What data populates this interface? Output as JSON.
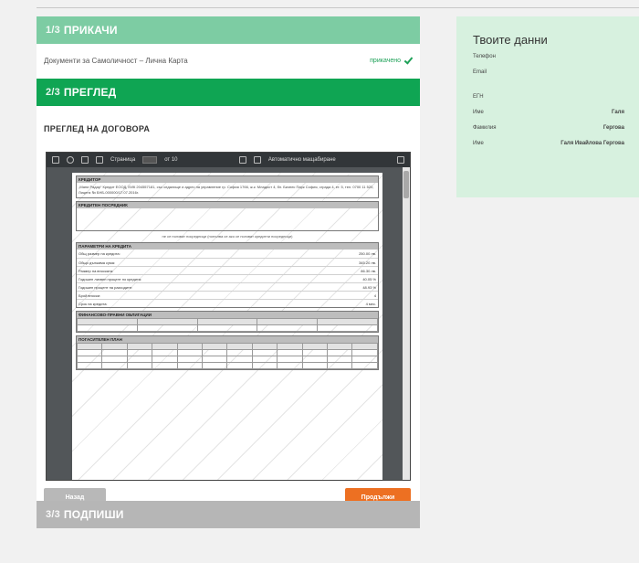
{
  "steps": {
    "step1": {
      "number": "1/3",
      "title": "ПРИКАЧИ"
    },
    "step2": {
      "number": "2/3",
      "title": "ПРЕГЛЕД"
    },
    "step3": {
      "number": "3/3",
      "title": "ПОДПИШИ"
    }
  },
  "upload": {
    "documents_text": "Документи за Самоличност – Лична Карта",
    "done_label": "прикачено"
  },
  "review": {
    "heading": "ПРЕГЛЕД НА ДОГОВОРА"
  },
  "viewer": {
    "page_label": "Страница",
    "page_of": "от 10",
    "zoom_label": "Автоматично мащабиране"
  },
  "pdf": {
    "creditor_head": "КРЕДИТОР",
    "creditor_body": "„Мани Радар“ Кредит ЕООД, ЕИК 204557181, със седалище и адрес на управление гр. София 1766, ж.к. Младост 4, бл. Бизнес Парк София, сграда 4, ет. 5, тел. 0700 11 520, Лиценз № БНБ-000000/17.07.2016г.",
    "intermediary_head": "КРЕДИТЕН ПОСРЕДНИК",
    "intermediary_note": "не се ползват посредници (попълва се ако се ползват кредитни посредници)",
    "params_head": "ПАРАМЕТРИ НА КРЕДИТА",
    "params": [
      {
        "label": "Общ размер на кредита:",
        "value": "250.00 лв."
      },
      {
        "label": "Общо дължима сума:",
        "value": "345.20 лв."
      },
      {
        "label": "Размер на вноската:",
        "value": "86.30 лв."
      },
      {
        "label": "Годишен лихвен процент по кредита:",
        "value": "40.05 %"
      },
      {
        "label": "Годишен процент на разходите:",
        "value": "48.93 %"
      },
      {
        "label": "Брой вноски:",
        "value": "4"
      },
      {
        "label": "Срок на кредита:",
        "value": "4 мес."
      }
    ],
    "financial_head": "ФИНАНСОВО-ПРАВНИ ОБЛИГАЦИИ",
    "schedule_head": "ПОГАСИТЕЛЕН ПЛАН"
  },
  "buttons": {
    "back": "Назад",
    "next": "Продължи"
  },
  "profile": {
    "title": "Твоите данни",
    "phone_label": "Телефон",
    "email_label": "Email",
    "egn_label": "ЕГН",
    "first_name_label": "Име",
    "first_name": "Галя",
    "last_name_label": "Фамилия",
    "last_name": "Гергова",
    "full_name_label": "Име",
    "full_name": "Галя Ивайлова Гергова"
  },
  "colors": {
    "step_active": "#0fa553",
    "step_done": "#7dcca3",
    "step_pending": "#b6b6b6",
    "next_button": "#ed7022",
    "panel_bg": "#d7f1df"
  }
}
